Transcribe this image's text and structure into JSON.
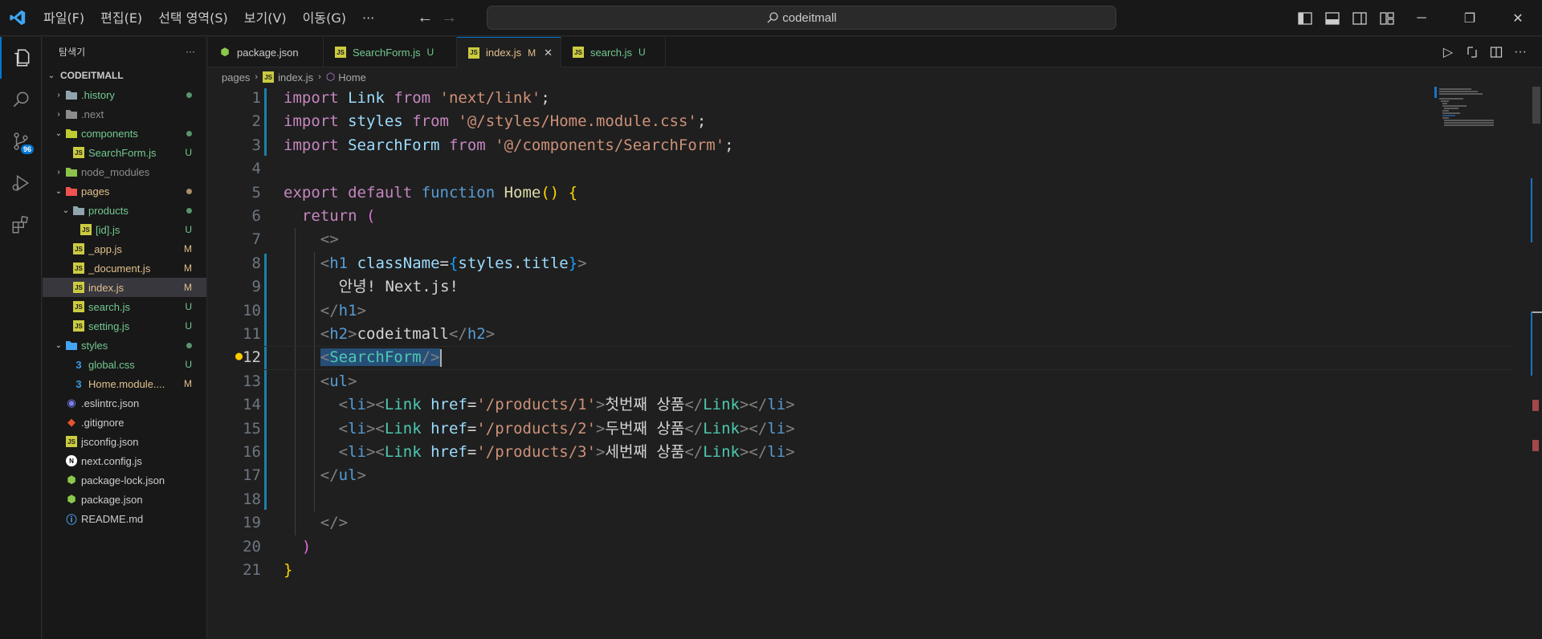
{
  "menu": [
    "파일(F)",
    "편집(E)",
    "선택 영역(S)",
    "보기(V)",
    "이동(G)",
    "···"
  ],
  "search_text": "codeitmall",
  "explorer": {
    "title": "탐색기",
    "more": "···",
    "root": "CODEITMALL"
  },
  "tree": [
    {
      "label": "history",
      "depth": 1,
      "type": "folder",
      "icon": "folder-icon",
      "open": false,
      "deco": "dot",
      "color": "#73c991"
    },
    {
      "label": ".next",
      "depth": 1,
      "type": "folder",
      "icon": "folder-next-icon",
      "open": false,
      "deco": "",
      "color": "#8c8c8c"
    },
    {
      "label": "components",
      "depth": 1,
      "type": "folder",
      "icon": "folder-components-icon",
      "open": true,
      "deco": "dot",
      "color": "#73c991"
    },
    {
      "label": "SearchForm.js",
      "depth": 2,
      "type": "js",
      "icon": "js-file-icon",
      "deco": "U",
      "color": "#73c991"
    },
    {
      "label": "node_modules",
      "depth": 1,
      "type": "folder",
      "icon": "folder-node-icon",
      "open": false,
      "deco": "",
      "color": "#8c8c8c"
    },
    {
      "label": "pages",
      "depth": 1,
      "type": "folder",
      "icon": "folder-pages-icon",
      "open": true,
      "deco": "dot",
      "color": "#e2c08d"
    },
    {
      "label": "products",
      "depth": 2,
      "type": "folder",
      "icon": "folder-icon",
      "open": true,
      "deco": "dot",
      "color": "#73c991"
    },
    {
      "label": "[id].js",
      "depth": 3,
      "type": "js",
      "icon": "js-file-icon",
      "deco": "U",
      "color": "#73c991"
    },
    {
      "label": "_app.js",
      "depth": 2,
      "type": "js",
      "icon": "js-file-icon",
      "deco": "M",
      "color": "#e2c08d"
    },
    {
      "label": "_document.js",
      "depth": 2,
      "type": "js",
      "icon": "js-file-icon",
      "deco": "M",
      "color": "#e2c08d"
    },
    {
      "label": "index.js",
      "depth": 2,
      "type": "js",
      "icon": "js-file-icon",
      "deco": "M",
      "color": "#e2c08d",
      "selected": true
    },
    {
      "label": "search.js",
      "depth": 2,
      "type": "js",
      "icon": "js-file-icon",
      "deco": "U",
      "color": "#73c991"
    },
    {
      "label": "setting.js",
      "depth": 2,
      "type": "js",
      "icon": "js-file-icon",
      "deco": "U",
      "color": "#73c991"
    },
    {
      "label": "styles",
      "depth": 1,
      "type": "folder",
      "icon": "folder-styles-icon",
      "open": true,
      "deco": "dot",
      "color": "#73c991"
    },
    {
      "label": "global.css",
      "depth": 2,
      "type": "css",
      "icon": "css-file-icon",
      "deco": "U",
      "color": "#73c991"
    },
    {
      "label": "Home.module....",
      "depth": 2,
      "type": "css",
      "icon": "css-file-icon",
      "deco": "M",
      "color": "#e2c08d"
    },
    {
      "label": ".eslintrc.json",
      "depth": 1,
      "type": "eslint",
      "icon": "eslint-file-icon",
      "deco": "",
      "color": "#cccccc"
    },
    {
      "label": ".gitignore",
      "depth": 1,
      "type": "git",
      "icon": "git-file-icon",
      "deco": "",
      "color": "#cccccc"
    },
    {
      "label": "jsconfig.json",
      "depth": 1,
      "type": "js",
      "icon": "json-file-icon",
      "deco": "",
      "color": "#cccccc"
    },
    {
      "label": "next.config.js",
      "depth": 1,
      "type": "next",
      "icon": "next-file-icon",
      "deco": "",
      "color": "#cccccc"
    },
    {
      "label": "package-lock.json",
      "depth": 1,
      "type": "node",
      "icon": "node-file-icon",
      "deco": "",
      "color": "#cccccc"
    },
    {
      "label": "package.json",
      "depth": 1,
      "type": "node",
      "icon": "node-file-icon",
      "deco": "",
      "color": "#cccccc"
    },
    {
      "label": "README.md",
      "depth": 1,
      "type": "info",
      "icon": "info-file-icon",
      "deco": "",
      "color": "#cccccc"
    }
  ],
  "tabs": [
    {
      "label": "package.json",
      "status": "",
      "icon": "node-file-icon",
      "color": "#cccccc"
    },
    {
      "label": "SearchForm.js",
      "status": "U",
      "icon": "js-file-icon",
      "color": "#73c991"
    },
    {
      "label": "index.js",
      "status": "M",
      "icon": "js-file-icon",
      "color": "#e2c08d",
      "active": true
    },
    {
      "label": "search.js",
      "status": "U",
      "icon": "js-file-icon",
      "color": "#73c991"
    }
  ],
  "breadcrumb": [
    "pages",
    "index.js",
    "Home"
  ],
  "badge_count": "96",
  "code_lines": [
    [
      [
        "kw",
        "import"
      ],
      [
        "wh",
        " "
      ],
      [
        "var",
        "Link"
      ],
      [
        "wh",
        " "
      ],
      [
        "kw",
        "from"
      ],
      [
        "wh",
        " "
      ],
      [
        "str",
        "'next/link'"
      ],
      [
        "wh",
        ";"
      ]
    ],
    [
      [
        "kw",
        "import"
      ],
      [
        "wh",
        " "
      ],
      [
        "var",
        "styles"
      ],
      [
        "wh",
        " "
      ],
      [
        "kw",
        "from"
      ],
      [
        "wh",
        " "
      ],
      [
        "str",
        "'@/styles/Home.module.css'"
      ],
      [
        "wh",
        ";"
      ]
    ],
    [
      [
        "kw",
        "import"
      ],
      [
        "wh",
        " "
      ],
      [
        "var",
        "SearchForm"
      ],
      [
        "wh",
        " "
      ],
      [
        "kw",
        "from"
      ],
      [
        "wh",
        " "
      ],
      [
        "str",
        "'@/components/SearchForm'"
      ],
      [
        "wh",
        ";"
      ]
    ],
    [],
    [
      [
        "kw",
        "export"
      ],
      [
        "wh",
        " "
      ],
      [
        "kw",
        "default"
      ],
      [
        "wh",
        " "
      ],
      [
        "bl",
        "function"
      ],
      [
        "wh",
        " "
      ],
      [
        "fn",
        "Home"
      ],
      [
        "br1",
        "()"
      ],
      [
        "wh",
        " "
      ],
      [
        "br1",
        "{"
      ]
    ],
    [
      [
        "wh",
        "  "
      ],
      [
        "kw",
        "return"
      ],
      [
        "wh",
        " "
      ],
      [
        "br2",
        "("
      ]
    ],
    [
      [
        "wh",
        "    "
      ],
      [
        "tagp",
        "<>"
      ]
    ],
    [
      [
        "wh",
        "    "
      ],
      [
        "tagp",
        "<"
      ],
      [
        "bl",
        "h1"
      ],
      [
        "wh",
        " "
      ],
      [
        "var",
        "className"
      ],
      [
        "wh",
        "="
      ],
      [
        "br3",
        "{"
      ],
      [
        "var",
        "styles"
      ],
      [
        "wh",
        "."
      ],
      [
        "var",
        "title"
      ],
      [
        "br3",
        "}"
      ],
      [
        "tagp",
        ">"
      ]
    ],
    [
      [
        "wh",
        "      안녕! Next.js!"
      ]
    ],
    [
      [
        "wh",
        "    "
      ],
      [
        "tagp",
        "</"
      ],
      [
        "bl",
        "h1"
      ],
      [
        "tagp",
        ">"
      ]
    ],
    [
      [
        "wh",
        "    "
      ],
      [
        "tagp",
        "<"
      ],
      [
        "bl",
        "h2"
      ],
      [
        "tagp",
        ">"
      ],
      [
        "wh",
        "codeitmall"
      ],
      [
        "tagp",
        "</"
      ],
      [
        "bl",
        "h2"
      ],
      [
        "tagp",
        ">"
      ]
    ],
    [
      [
        "wh",
        "    "
      ],
      [
        "tagp sel-hl",
        "<"
      ],
      [
        "cls sel-hl",
        "SearchForm"
      ],
      [
        "tagp sel-hl",
        "/>"
      ]
    ],
    [
      [
        "wh",
        "    "
      ],
      [
        "tagp",
        "<"
      ],
      [
        "bl",
        "ul"
      ],
      [
        "tagp",
        ">"
      ]
    ],
    [
      [
        "wh",
        "      "
      ],
      [
        "tagp",
        "<"
      ],
      [
        "bl",
        "li"
      ],
      [
        "tagp",
        "><"
      ],
      [
        "cls",
        "Link"
      ],
      [
        "wh",
        " "
      ],
      [
        "var",
        "href"
      ],
      [
        "wh",
        "="
      ],
      [
        "str",
        "'/products/1'"
      ],
      [
        "tagp",
        ">"
      ],
      [
        "wh",
        "첫번째 상품"
      ],
      [
        "tagp",
        "</"
      ],
      [
        "cls",
        "Link"
      ],
      [
        "tagp",
        "></"
      ],
      [
        "bl",
        "li"
      ],
      [
        "tagp",
        ">"
      ]
    ],
    [
      [
        "wh",
        "      "
      ],
      [
        "tagp",
        "<"
      ],
      [
        "bl",
        "li"
      ],
      [
        "tagp",
        "><"
      ],
      [
        "cls",
        "Link"
      ],
      [
        "wh",
        " "
      ],
      [
        "var",
        "href"
      ],
      [
        "wh",
        "="
      ],
      [
        "str",
        "'/products/2'"
      ],
      [
        "tagp",
        ">"
      ],
      [
        "wh",
        "두번째 상품"
      ],
      [
        "tagp",
        "</"
      ],
      [
        "cls",
        "Link"
      ],
      [
        "tagp",
        "></"
      ],
      [
        "bl",
        "li"
      ],
      [
        "tagp",
        ">"
      ]
    ],
    [
      [
        "wh",
        "      "
      ],
      [
        "tagp",
        "<"
      ],
      [
        "bl",
        "li"
      ],
      [
        "tagp",
        "><"
      ],
      [
        "cls",
        "Link"
      ],
      [
        "wh",
        " "
      ],
      [
        "var",
        "href"
      ],
      [
        "wh",
        "="
      ],
      [
        "str",
        "'/products/3'"
      ],
      [
        "tagp",
        ">"
      ],
      [
        "wh",
        "세번째 상품"
      ],
      [
        "tagp",
        "</"
      ],
      [
        "cls",
        "Link"
      ],
      [
        "tagp",
        "></"
      ],
      [
        "bl",
        "li"
      ],
      [
        "tagp",
        ">"
      ]
    ],
    [
      [
        "wh",
        "    "
      ],
      [
        "tagp",
        "</"
      ],
      [
        "bl",
        "ul"
      ],
      [
        "tagp",
        ">"
      ]
    ],
    [],
    [
      [
        "wh",
        "    "
      ],
      [
        "tagp",
        "</>"
      ]
    ],
    [
      [
        "wh",
        "  "
      ],
      [
        "br2",
        ")"
      ]
    ],
    [
      [
        "br1",
        "}"
      ]
    ]
  ],
  "current_line": 12
}
